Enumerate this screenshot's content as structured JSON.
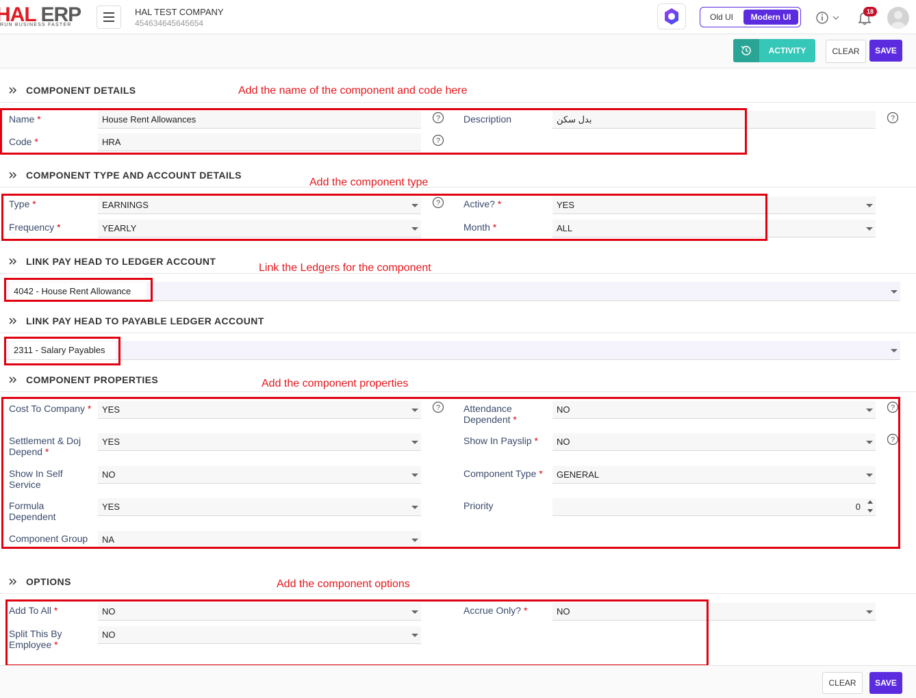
{
  "header": {
    "logo_main_a": "HAL",
    "logo_main_b": "ERP",
    "logo_tagline": "RUN BUSINESS FASTER",
    "company_name": "HAL TEST COMPANY",
    "company_id": "454634645645654",
    "ui_old_label": "Old UI",
    "ui_modern_label": "Modern UI",
    "notification_count": "18"
  },
  "actions": {
    "activity_label": "ACTIVITY",
    "clear_label": "CLEAR",
    "save_label": "SAVE"
  },
  "sections": {
    "component_details": {
      "title": "COMPONENT DETAILS",
      "annotation": "Add the name of the component and code here",
      "name_label": "Name",
      "name_value": "House Rent Allowances",
      "code_label": "Code",
      "code_value": "HRA",
      "description_label": "Description",
      "description_value": "بدل سكن"
    },
    "type_account": {
      "title": "COMPONENT TYPE AND ACCOUNT DETAILS",
      "annotation": "Add the component type",
      "type_label": "Type",
      "type_value": "EARNINGS",
      "frequency_label": "Frequency",
      "frequency_value": "YEARLY",
      "active_label": "Active?",
      "active_value": "YES",
      "month_label": "Month",
      "month_value": "ALL"
    },
    "ledger": {
      "title": "LINK PAY HEAD TO LEDGER ACCOUNT",
      "annotation": "Link the Ledgers for the component",
      "value": "4042 - House Rent Allowance"
    },
    "payable": {
      "title": "LINK PAY HEAD TO PAYABLE LEDGER ACCOUNT",
      "value": "2311 - Salary Payables"
    },
    "properties": {
      "title": "COMPONENT PROPERTIES",
      "annotation": "Add the component properties",
      "ctc_label": "Cost To Company",
      "ctc_value": "YES",
      "attendance_label_1": "Attendance",
      "attendance_label_2": "Dependent",
      "attendance_value": "NO",
      "settlement_label_1": "Settlement & Doj",
      "settlement_label_2": "Depend",
      "settlement_value": "YES",
      "payslip_label": "Show In Payslip",
      "payslip_value": "NO",
      "selfservice_label_1": "Show In Self",
      "selfservice_label_2": "Service",
      "selfservice_value": "NO",
      "comptype_label": "Component Type",
      "comptype_value": "GENERAL",
      "formula_label_1": "Formula",
      "formula_label_2": "Dependent",
      "formula_value": "YES",
      "priority_label": "Priority",
      "priority_value": "0",
      "group_label": "Component Group",
      "group_value": "NA"
    },
    "options": {
      "title": "OPTIONS",
      "annotation": "Add the component options",
      "addtoall_label": "Add To All",
      "addtoall_value": "NO",
      "accrue_label": "Accrue Only?",
      "accrue_value": "NO",
      "split_label_1": "Split This By",
      "split_label_2": "Employee",
      "split_value": "NO"
    }
  },
  "colors": {
    "brand_red": "#e01b22",
    "accent_purple": "#5b2be0",
    "activity_teal": "#35c7b7",
    "annotation_red": "#e3171c",
    "label_blue": "#3a4a6b"
  }
}
